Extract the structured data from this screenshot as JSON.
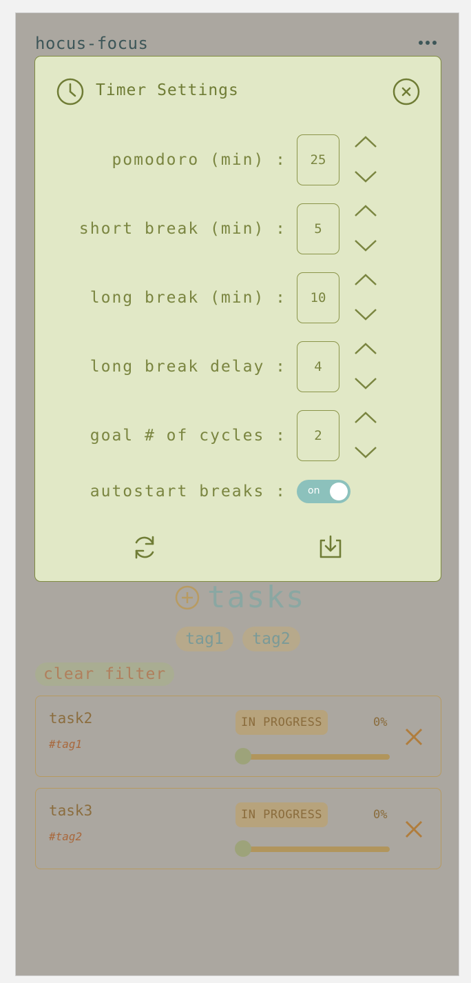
{
  "app": {
    "title": "hocus-focus"
  },
  "tasks_section": {
    "title": "tasks",
    "tags": [
      "tag1",
      "tag2"
    ],
    "clear_filter_label": "clear filter",
    "items": [
      {
        "name": "task2",
        "tag": "#tag1",
        "status": "IN PROGRESS",
        "percent_label": "0%",
        "progress": 0
      },
      {
        "name": "task3",
        "tag": "#tag2",
        "status": "IN PROGRESS",
        "percent_label": "0%",
        "progress": 0
      }
    ]
  },
  "timer_settings": {
    "title": "Timer Settings",
    "fields": [
      {
        "label": "pomodoro (min) :",
        "value": "25"
      },
      {
        "label": "short break (min) :",
        "value": "5"
      },
      {
        "label": "long break (min) :",
        "value": "10"
      },
      {
        "label": "long break delay :",
        "value": "4"
      },
      {
        "label": "goal # of cycles :",
        "value": "2"
      }
    ],
    "autostart": {
      "label": "autostart breaks :",
      "toggle_text": "on",
      "enabled": true
    }
  },
  "colors": {
    "modal_bg": "#e1e8c6",
    "accent_olive": "#7a8540",
    "toggle_on": "#8cc1bc",
    "overlay_bg": "#aba7a0"
  },
  "icons": {
    "title": "clock-icon",
    "close": "close-circle-icon",
    "increment": "chevron-up-icon",
    "decrement": "chevron-down-icon",
    "reset": "refresh-icon",
    "save": "download-icon",
    "add": "plus-circle-icon",
    "delete": "x-icon",
    "menu": "ellipsis-icon"
  }
}
